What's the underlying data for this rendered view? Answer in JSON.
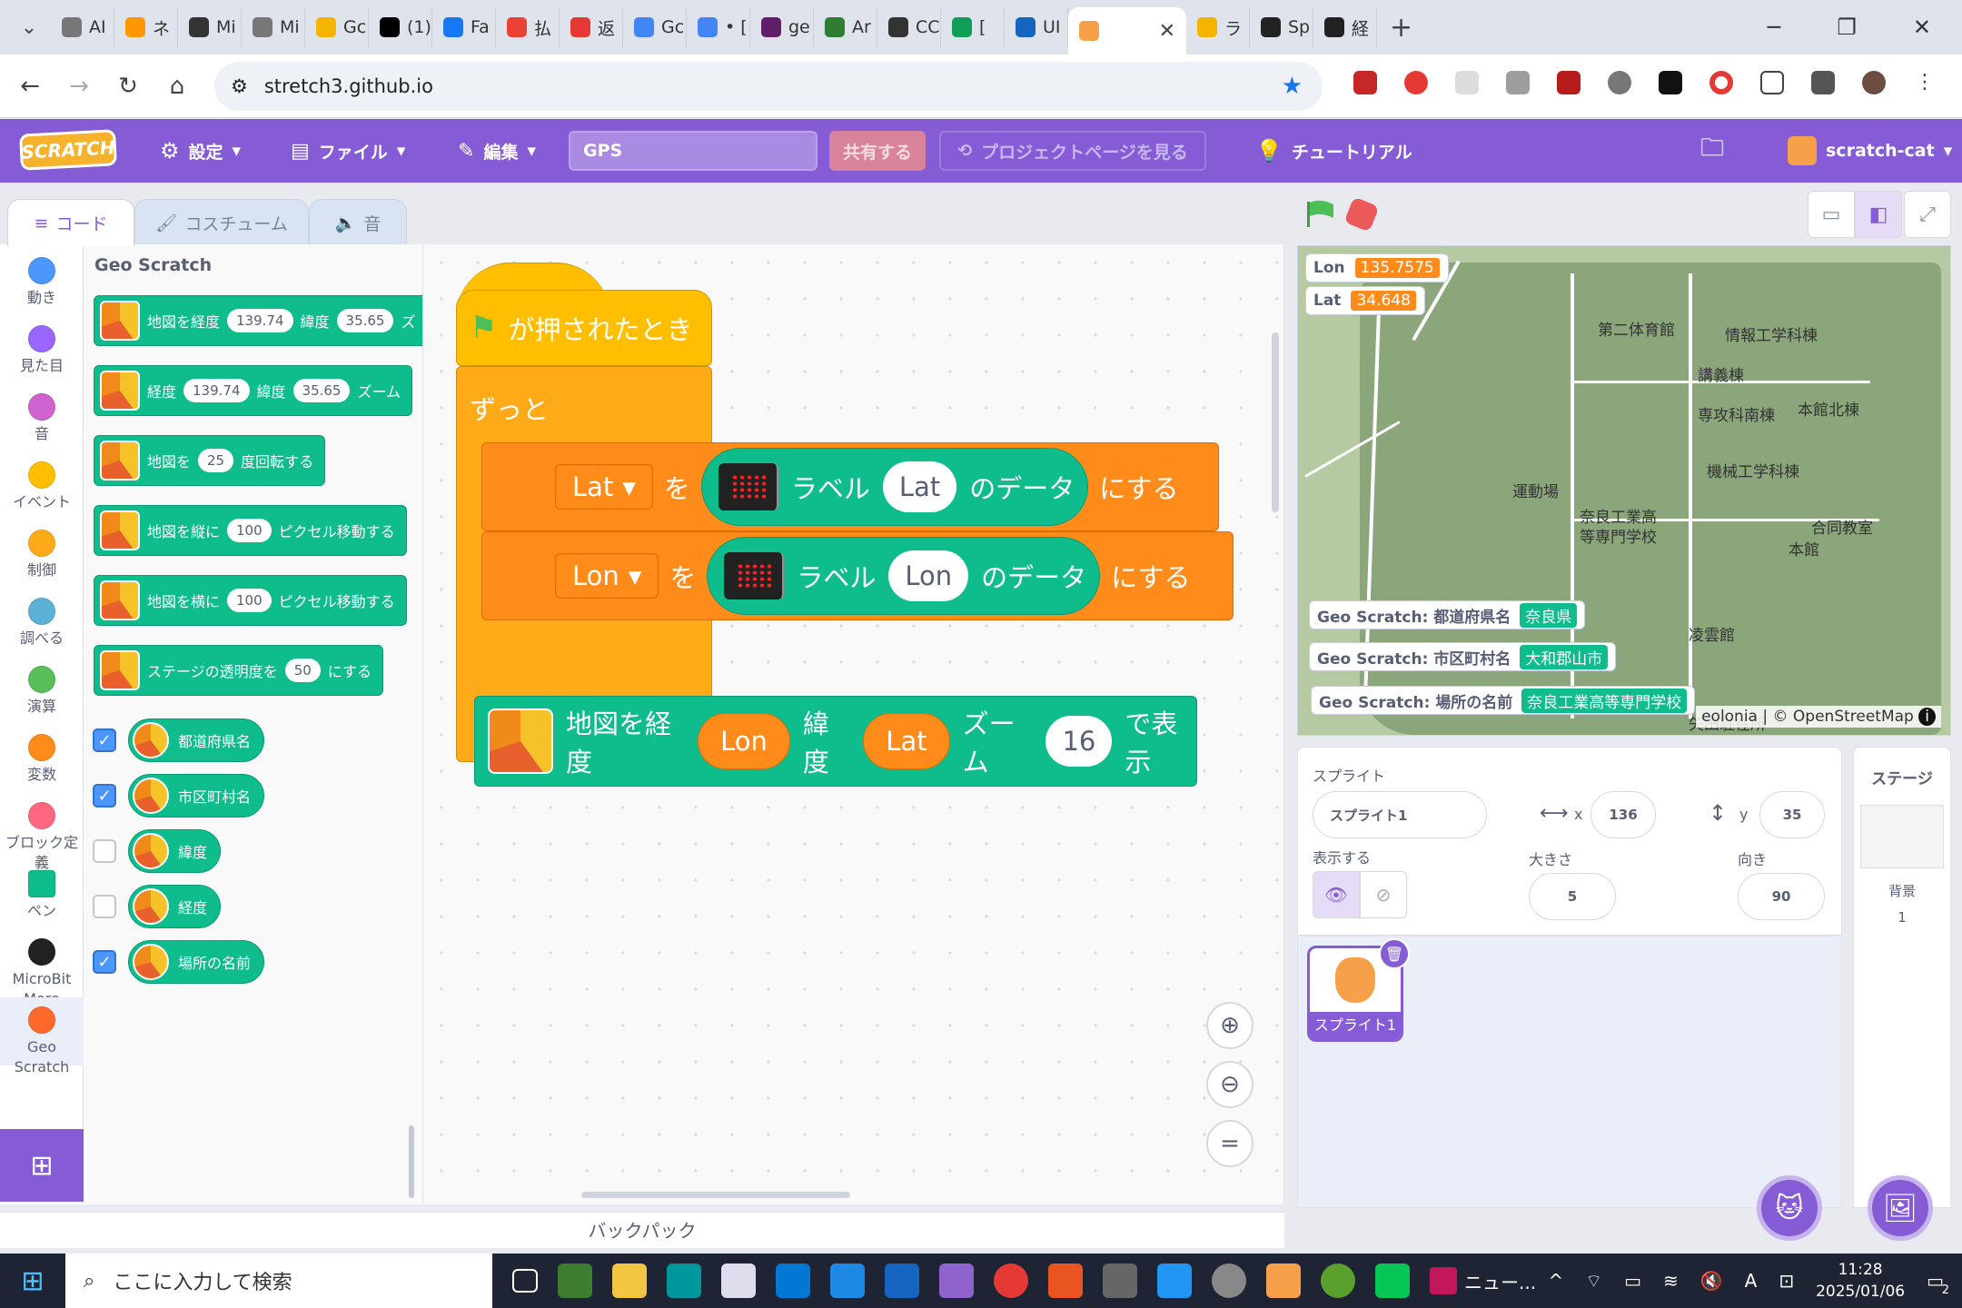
{
  "browser": {
    "tabs": [
      "AI",
      "ネ",
      "Mi",
      "Mi",
      "Gc",
      "(1)",
      "Fa",
      "払",
      "返",
      "Gc",
      "• [",
      "ge",
      "Ar",
      "CC",
      "[",
      "UI",
      "",
      "ラ",
      "Sp",
      "経"
    ],
    "active_close": "✕",
    "url": "stretch3.github.io"
  },
  "scratch_menu": {
    "settings": "設定",
    "file": "ファイル",
    "edit": "編集",
    "title": "GPS",
    "share": "共有する",
    "project_page": "プロジェクトページを見る",
    "tutorial": "チュートリアル",
    "user": "scratch-cat"
  },
  "editor_tabs": {
    "code": "コード",
    "costume": "コスチューム",
    "sound": "音"
  },
  "categories": [
    "動き",
    "見た目",
    "音",
    "イベント",
    "制御",
    "調べる",
    "演算",
    "変数",
    "ブロック定義",
    "ペン",
    "MicroBit More",
    "Geo Scratch"
  ],
  "category_colors": [
    "#4c97ff",
    "#9966ff",
    "#cf63cf",
    "#ffbf00",
    "#ffab19",
    "#5cb1d6",
    "#59c059",
    "#ff8c1a",
    "#ff6680",
    "#0fbd8c",
    "#222222",
    "#ff6a2c"
  ],
  "palette": {
    "title": "Geo Scratch",
    "blocks": [
      {
        "parts": [
          "地図を経度",
          "139.74",
          "緯度",
          "35.65",
          "ズ"
        ]
      },
      {
        "parts": [
          "経度",
          "139.74",
          "緯度",
          "35.65",
          "ズーム"
        ]
      },
      {
        "parts": [
          "地図を",
          "25",
          "度回転する"
        ]
      },
      {
        "parts": [
          "地図を縦に",
          "100",
          "ピクセル移動する"
        ]
      },
      {
        "parts": [
          "地図を横に",
          "100",
          "ピクセル移動する"
        ]
      },
      {
        "parts": [
          "ステージの透明度を",
          "50",
          "にする"
        ]
      }
    ],
    "reporters": [
      {
        "label": "都道府県名",
        "checked": true
      },
      {
        "label": "市区町村名",
        "checked": true
      },
      {
        "label": "緯度",
        "checked": false
      },
      {
        "label": "経度",
        "checked": false
      },
      {
        "label": "場所の名前",
        "checked": true
      }
    ]
  },
  "script": {
    "hat": "が押されたとき",
    "forever": "ずっと",
    "set_lat": {
      "var": "Lat",
      "wo": "を",
      "label": "ラベル",
      "key": "Lat",
      "data": "のデータ",
      "suru": "にする"
    },
    "set_lon": {
      "var": "Lon",
      "wo": "を",
      "label": "ラベル",
      "key": "Lon",
      "data": "のデータ",
      "suru": "にする"
    },
    "geo": {
      "p1": "地図を経度",
      "lon": "Lon",
      "p2": "緯度",
      "lat": "Lat",
      "p3": "ズーム",
      "zoom": "16",
      "p4": "で表示"
    }
  },
  "backpack": "バックパック",
  "stage": {
    "monitors": [
      {
        "name": "Lon",
        "value": "135.7575"
      },
      {
        "name": "Lat",
        "value": "34.648"
      }
    ],
    "geo_monitors": [
      {
        "name": "Geo Scratch: 都道府県名",
        "value": "奈良県"
      },
      {
        "name": "Geo Scratch: 市区町村名",
        "value": "大和郡山市"
      },
      {
        "name": "Geo Scratch: 場所の名前",
        "value": "奈良工業高等専門学校"
      }
    ],
    "map_labels": [
      "第二体育館",
      "情報工学科棟",
      "講義棟",
      "専攻科南棟",
      "本館北棟",
      "機械工学科棟",
      "運動場",
      "奈良工業高",
      "等専門学校",
      "合同教室",
      "本館",
      "凌雲館",
      "矢田駐在所"
    ],
    "attribution": "eolonia | © OpenStreetMap"
  },
  "sprite_info": {
    "sprite_label": "スプライト",
    "name": "スプライト1",
    "x_label": "x",
    "x": "136",
    "y_label": "y",
    "y": "35",
    "show_label": "表示する",
    "size_label": "大きさ",
    "size": "5",
    "direction_label": "向き",
    "direction": "90"
  },
  "sprite_card": "スプライト1",
  "stage_panel": {
    "title": "ステージ",
    "backdrop_label": "背景",
    "backdrop_count": "1"
  },
  "taskbar": {
    "search": "ここに入力して検索",
    "app_label": "ニュー...",
    "time": "11:28",
    "date": "2025/01/06",
    "notif": "2",
    "ime": "A"
  }
}
